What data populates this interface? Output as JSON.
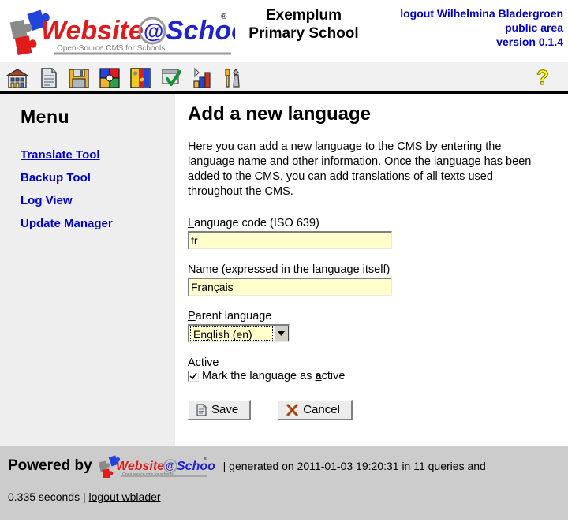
{
  "header": {
    "logo_alt": "Website@School",
    "logo_word1": "Website",
    "logo_word2": "@",
    "logo_word3": "School",
    "logo_tagline": "Open-Source CMS for Schools",
    "logo_registered": "®",
    "school_name_line1": "Exemplum",
    "school_name_line2": "Primary School",
    "logout_label": "logout Wilhelmina Bladergroen",
    "area_label": "public area",
    "version_label": "version 0.1.4"
  },
  "toolbar": {
    "icons": [
      {
        "name": "school-icon",
        "title": "School"
      },
      {
        "name": "page-icon",
        "title": "Pages"
      },
      {
        "name": "save-disk-icon",
        "title": "Save"
      },
      {
        "name": "modules-icon",
        "title": "Modules"
      },
      {
        "name": "themes-icon",
        "title": "Themes"
      },
      {
        "name": "tasks-icon",
        "title": "Tasks"
      },
      {
        "name": "statistics-icon",
        "title": "Statistics"
      },
      {
        "name": "tools-icon",
        "title": "Tools"
      }
    ],
    "help": {
      "name": "help-icon",
      "title": "Help",
      "glyph": "?"
    }
  },
  "sidebar": {
    "title": "Menu",
    "items": [
      {
        "label": "Translate Tool",
        "current": true
      },
      {
        "label": "Backup Tool",
        "current": false
      },
      {
        "label": "Log View",
        "current": false
      },
      {
        "label": "Update Manager",
        "current": false
      }
    ]
  },
  "main": {
    "title": "Add a new language",
    "intro": "Here you can add a new language to the CMS by entering the language name and other information. Once the language has been added to the CMS, you can add translations of all texts used throughout the CMS.",
    "fields": {
      "language_code": {
        "label_accesskey": "L",
        "label_rest": "anguage code (ISO 639)",
        "value": "fr",
        "placeholder": ""
      },
      "name": {
        "label_accesskey": "N",
        "label_rest": "ame (expressed in the language itself)",
        "value": "Français",
        "placeholder": ""
      },
      "parent_language": {
        "label_accesskey": "P",
        "label_rest": "arent language",
        "selected": "English (en)",
        "options": [
          "English (en)"
        ]
      },
      "active": {
        "group_label": "Active",
        "checkbox_text_before": "Mark the language as ",
        "checkbox_accesskey": "a",
        "checkbox_text_after": "ctive",
        "checked": true
      }
    },
    "buttons": {
      "save": {
        "label": "Save",
        "icon": "document-icon"
      },
      "cancel": {
        "label": "Cancel",
        "icon": "cross-icon"
      }
    }
  },
  "footer": {
    "powered_by": "Powered by",
    "logo_word1": "Website",
    "logo_word2": "@",
    "logo_word3": "School",
    "logo_tagline": "Open source cms for schools",
    "generated_text": "| generated on 2011-01-03 19:20:31 in 11 queries and",
    "seconds_text": "0.335 seconds |",
    "logout_link": "logout wblader"
  },
  "colors": {
    "link_blue": "#0000cc",
    "logo_red": "#e01b1b",
    "logo_blue": "#2222cc",
    "field_yellow": "#ffffcc",
    "sidebar_gray": "#eeeeee",
    "footer_gray": "#cccccc",
    "help_yellow": "#ffff00"
  }
}
